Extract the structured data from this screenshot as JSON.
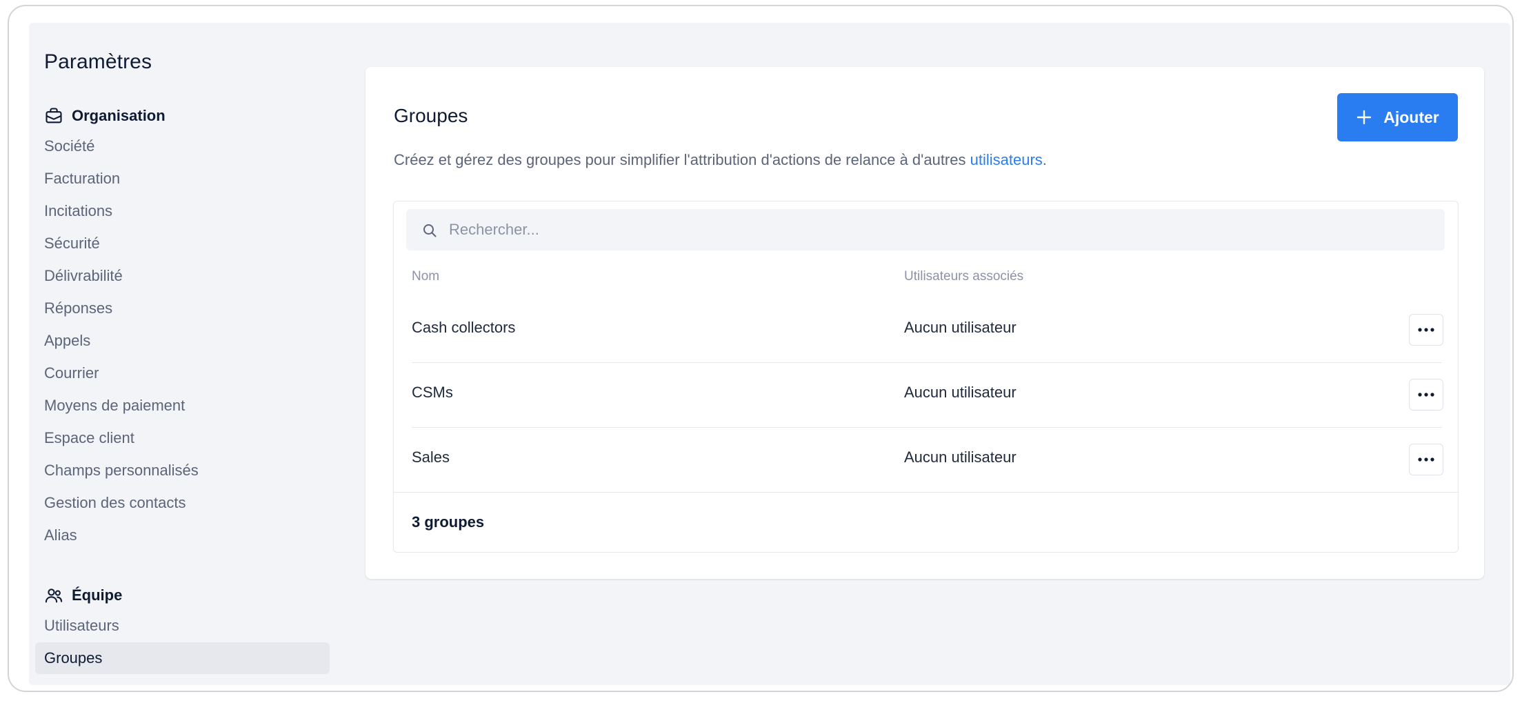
{
  "sidebar": {
    "title": "Paramètres",
    "sections": [
      {
        "label": "Organisation",
        "icon": "briefcase-icon",
        "items": [
          "Société",
          "Facturation",
          "Incitations",
          "Sécurité",
          "Délivrabilité",
          "Réponses",
          "Appels",
          "Courrier",
          "Moyens de paiement",
          "Espace client",
          "Champs personnalisés",
          "Gestion des contacts",
          "Alias"
        ]
      },
      {
        "label": "Équipe",
        "icon": "users-icon",
        "items": [
          "Utilisateurs",
          "Groupes"
        ]
      }
    ],
    "active_item": "Groupes"
  },
  "main": {
    "title": "Groupes",
    "add_button": {
      "label": "Ajouter",
      "icon": "plus-icon"
    },
    "description_prefix": "Créez et gérez des groupes pour simplifier l'attribution d'actions de relance à d'autres ",
    "description_link": "utilisateurs",
    "description_suffix": ".",
    "search": {
      "placeholder": "Rechercher...",
      "value": "",
      "icon": "search-icon"
    },
    "columns": {
      "name": "Nom",
      "users": "Utilisateurs associés"
    },
    "rows": [
      {
        "name": "Cash collectors",
        "users": "Aucun utilisateur"
      },
      {
        "name": "CSMs",
        "users": "Aucun utilisateur"
      },
      {
        "name": "Sales",
        "users": "Aucun utilisateur"
      }
    ],
    "count": "3 groupes"
  },
  "colors": {
    "accent": "#2a7df0",
    "background": "#f3f4f7",
    "text_primary": "#0f1b33",
    "text_secondary": "#5b6478",
    "active_item_bg": "#e6e8ee"
  }
}
